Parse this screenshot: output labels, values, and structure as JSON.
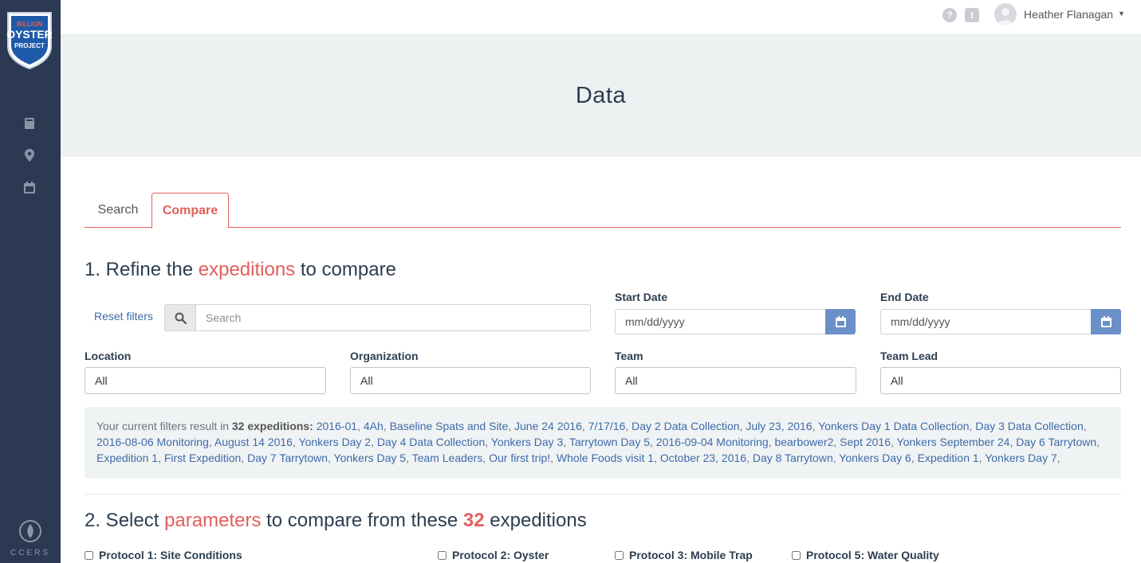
{
  "brand": {
    "logo_line1": "BILLION",
    "logo_line2": "OYSTER",
    "logo_line3": "PROJECT",
    "footer_logo_text": "CCERS"
  },
  "sidebar": {
    "icons": [
      "book-icon",
      "map-marker-icon",
      "calendar-icon"
    ]
  },
  "topbar": {
    "user_name": "Heather Flanagan",
    "help_icon": "?",
    "tumblr_icon": "t"
  },
  "hero": {
    "title": "Data"
  },
  "tabs": [
    {
      "label": "Search"
    },
    {
      "label": "Compare"
    }
  ],
  "section1": {
    "prefix": "1. Refine the ",
    "accent": "expeditions",
    "suffix": " to compare",
    "reset_label": "Reset filters",
    "search_placeholder": "Search",
    "start_date_label": "Start Date",
    "start_date_placeholder": "mm/dd/yyyy",
    "end_date_label": "End Date",
    "end_date_placeholder": "mm/dd/yyyy",
    "location_label": "Location",
    "location_value": "All",
    "organization_label": "Organization",
    "organization_value": "All",
    "team_label": "Team",
    "team_value": "All",
    "team_lead_label": "Team Lead",
    "team_lead_value": "All"
  },
  "filters_result": {
    "prefix": "Your current filters result in ",
    "count_text": "32 expeditions:",
    "expeditions": [
      "2016-01",
      "4Ah",
      "Baseline Spats and Site",
      "June 24 2016",
      "7/17/16",
      "Day 2 Data Collection",
      "July 23, 2016",
      "Yonkers Day 1 Data Collection",
      "Day 3 Data Collection",
      "2016-08-06 Monitoring",
      "August 14 2016",
      "Yonkers Day 2",
      "Day 4 Data Collection",
      "Yonkers Day 3",
      "Tarrytown Day 5",
      "2016-09-04 Monitoring",
      "bearbower2",
      "Sept 2016",
      "Yonkers September 24",
      "Day 6 Tarrytown",
      "Expedition 1",
      "First Expedition",
      "Day 7 Tarrytown",
      "Yonkers Day 5",
      "Team Leaders",
      "Our first trip!",
      "Whole Foods visit 1",
      "October 23, 2016",
      "Day 8 Tarrytown",
      "Yonkers Day 6",
      "Expedition 1",
      "Yonkers Day 7"
    ]
  },
  "section2": {
    "prefix": "2. Select ",
    "accent": "parameters",
    "middle": " to compare from these ",
    "count": "32",
    "suffix": " expeditions",
    "protocols": [
      {
        "label": "Protocol 1: Site Conditions"
      },
      {
        "label": "Protocol 2: Oyster"
      },
      {
        "label": "Protocol 3: Mobile Trap"
      },
      {
        "label": "Protocol 5: Water Quality"
      }
    ]
  }
}
